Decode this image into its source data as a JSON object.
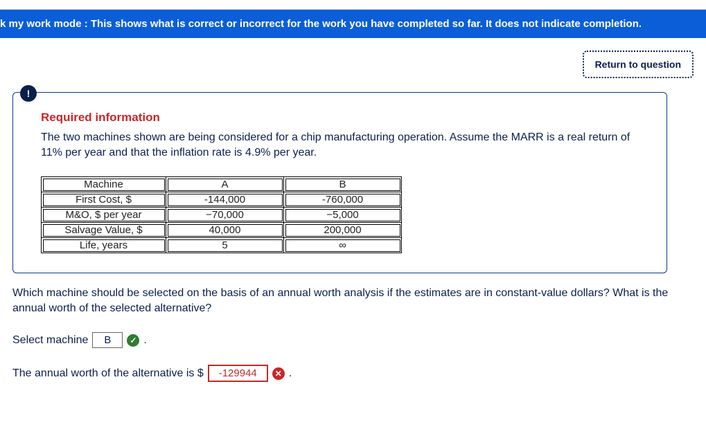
{
  "banner": {
    "text": "k my work mode : This shows what is correct or incorrect for the work you have completed so far. It does not indicate completion."
  },
  "toolbar": {
    "return_label": "Return to question"
  },
  "badge": {
    "glyph": "!"
  },
  "required": {
    "heading": "Required information",
    "body": "The two machines shown are being considered for a chip manufacturing operation. Assume the MARR is a real return of 11% per year and that the inflation rate is 4.9% per year."
  },
  "table": {
    "rows": [
      {
        "label": "Machine",
        "a": "A",
        "b": "B"
      },
      {
        "label": "First Cost, $",
        "a": "-144,000",
        "b": "-760,000"
      },
      {
        "label": "M&O, $ per year",
        "a": "−70,000",
        "b": "−5,000"
      },
      {
        "label": "Salvage Value, $",
        "a": "40,000",
        "b": "200,000"
      },
      {
        "label": "Life, years",
        "a": "5",
        "b": "∞"
      }
    ]
  },
  "question": {
    "text": "Which machine should be selected on the basis of an annual worth analysis if the estimates are in constant-value dollars? What is the annual worth of the selected alternative?"
  },
  "answers": {
    "select_label": "Select machine",
    "select_value": "B",
    "select_status": "correct",
    "worth_label_pre": "The annual worth of the alternative is $",
    "worth_value": "-129944",
    "worth_status": "incorrect",
    "period": "."
  },
  "icons": {
    "check": "✓",
    "cross": "✕"
  }
}
